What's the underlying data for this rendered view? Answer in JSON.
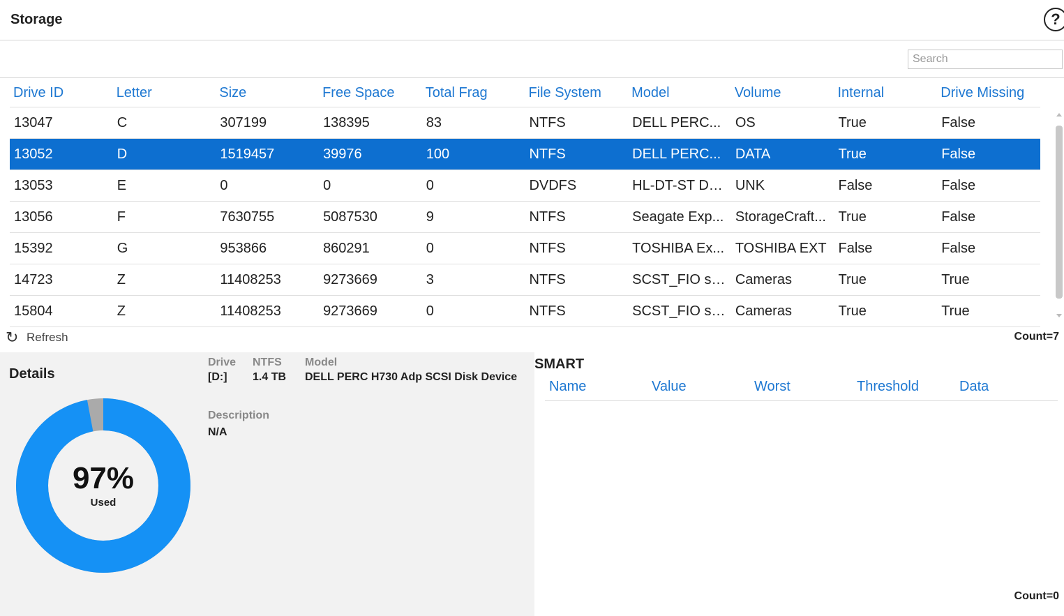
{
  "header": {
    "title": "Storage",
    "help_icon": "?"
  },
  "search": {
    "placeholder": "Search"
  },
  "grid": {
    "columns": [
      "Drive ID",
      "Letter",
      "Size",
      "Free Space",
      "Total Frag",
      "File System",
      "Model",
      "Volume",
      "Internal",
      "Drive Missing"
    ],
    "selected_row": 1,
    "rows": [
      [
        "13047",
        "C",
        "307199",
        "138395",
        "83",
        "NTFS",
        "DELL PERC...",
        "OS",
        "True",
        "False"
      ],
      [
        "13052",
        "D",
        "1519457",
        "39976",
        "100",
        "NTFS",
        "DELL PERC...",
        "DATA",
        "True",
        "False"
      ],
      [
        "13053",
        "E",
        "0",
        "0",
        "0",
        "DVDFS",
        "HL-DT-ST DV...",
        "UNK",
        "False",
        "False"
      ],
      [
        "13056",
        "F",
        "7630755",
        "5087530",
        "9",
        "NTFS",
        "Seagate Exp...",
        "StorageCraft...",
        "True",
        "False"
      ],
      [
        "15392",
        "G",
        "953866",
        "860291",
        "0",
        "NTFS",
        "TOSHIBA Ex...",
        "TOSHIBA EXT",
        "False",
        "False"
      ],
      [
        "14723",
        "Z",
        "11408253",
        "9273669",
        "3",
        "NTFS",
        "SCST_FIO sp...",
        "Cameras",
        "True",
        "True"
      ],
      [
        "15804",
        "Z",
        "11408253",
        "9273669",
        "0",
        "NTFS",
        "SCST_FIO sp...",
        "Cameras",
        "True",
        "True"
      ]
    ]
  },
  "toolbar": {
    "refresh_label": "Refresh",
    "refresh_icon": "↻",
    "count": "Count=7"
  },
  "details": {
    "title": "Details",
    "used_percent_text": "97%",
    "used_label": "Used",
    "used_fraction": 0.97,
    "drive_label": "Drive",
    "drive_value": "[D:]",
    "fs_label": "NTFS",
    "fs_value": "1.4 TB",
    "model_label": "Model",
    "model_value": "DELL PERC H730 Adp SCSI Disk Device",
    "description_label": "Description",
    "description_value": "N/A"
  },
  "smart": {
    "title": "SMART",
    "columns": [
      "Name",
      "Value",
      "Worst",
      "Threshold",
      "Data"
    ],
    "count": "Count=0"
  },
  "colors": {
    "accent": "#1e78d2",
    "selected_row": "#0d6fd0",
    "donut_used": "#1591f5",
    "donut_free": "#aaaaaa"
  }
}
